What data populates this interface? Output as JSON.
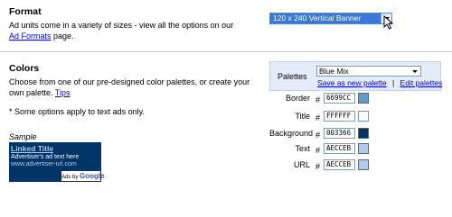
{
  "format": {
    "heading": "Format",
    "desc_before": "Ad units come in a variety of sizes - view all the options on our ",
    "desc_link": "Ad Formats",
    "desc_after": " page.",
    "selected": "120 x 240 Vertical Banner"
  },
  "colors": {
    "heading": "Colors",
    "desc": "Choose from one of our pre-designed color palettes, or create your own palette. ",
    "tips_link": "Tips",
    "note": "* Some options apply to text ads only.",
    "sample_label": "Sample",
    "palettes_label": "Palettes",
    "palette_selected": "Blue Mix",
    "save_link": "Save as new palette",
    "sep": "|",
    "edit_link": "Edit palettes",
    "hash": "#",
    "rows": [
      {
        "label": "Border",
        "value": "6699CC",
        "color": "#6699cc"
      },
      {
        "label": "Title",
        "value": "FFFFFF",
        "color": "#ffffff"
      },
      {
        "label": "Background",
        "value": "003366",
        "color": "#003366"
      },
      {
        "label": "Text",
        "value": "AECCEB",
        "color": "#aecceb"
      },
      {
        "label": "URL",
        "value": "AECCEB",
        "color": "#aecceb"
      }
    ]
  },
  "sample_ad": {
    "title": "Linked Title",
    "text": "Advertiser's ad text here",
    "url": "www.advertiser-url.com",
    "badge_prefix": "Ads by",
    "badge_brand": "Google"
  }
}
